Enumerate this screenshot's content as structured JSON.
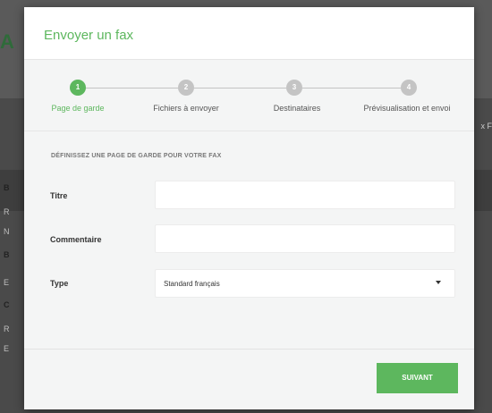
{
  "modal": {
    "title": "Envoyer un fax",
    "steps": [
      {
        "number": "1",
        "label": "Page de garde"
      },
      {
        "number": "2",
        "label": "Fichiers à envoyer"
      },
      {
        "number": "3",
        "label": "Destinataires"
      },
      {
        "number": "4",
        "label": "Prévisualisation et envoi"
      }
    ],
    "active_step": 1,
    "section_title": "DÉFINISSEZ UNE PAGE DE GARDE POUR VOTRE FAX",
    "fields": {
      "title_label": "Titre",
      "title_value": "",
      "comment_label": "Commentaire",
      "comment_value": "",
      "type_label": "Type",
      "type_value": "Standard français"
    },
    "next_button": "SUIVANT"
  },
  "background": {
    "logo_fragment": "A",
    "side_letters": [
      "B",
      "R",
      "N",
      "B",
      "E",
      "C",
      "R",
      "E"
    ],
    "right_fragment": "x F"
  },
  "colors": {
    "accent": "#5db75e",
    "inactive_step": "#c4c4c4"
  }
}
